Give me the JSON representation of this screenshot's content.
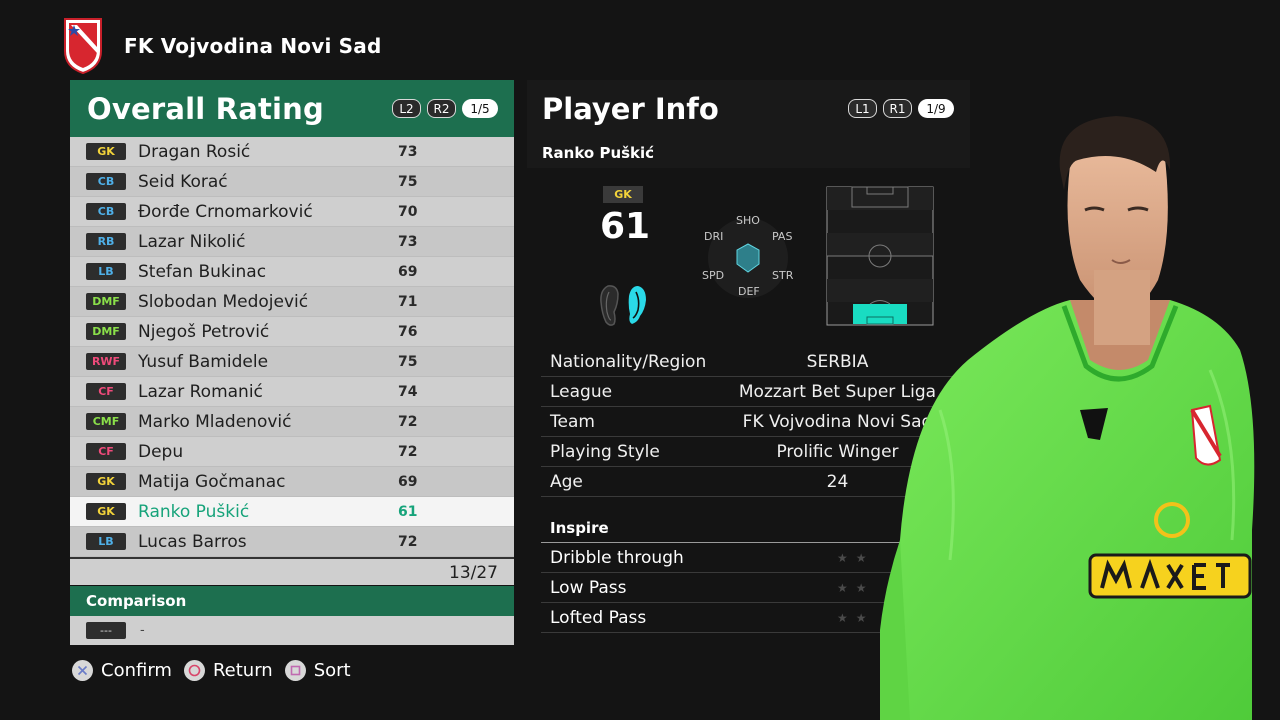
{
  "club": {
    "name": "FK Vojvodina Novi Sad"
  },
  "overall": {
    "title": "Overall Rating",
    "l_button": "L2",
    "r_button": "R2",
    "page": "1/5",
    "players": [
      {
        "pos": "GK",
        "pos_color": "#f2d33a",
        "name": "Dragan Rosić",
        "rating": "73"
      },
      {
        "pos": "CB",
        "pos_color": "#4fb0e8",
        "name": "Seid Korać",
        "rating": "75"
      },
      {
        "pos": "CB",
        "pos_color": "#4fb0e8",
        "name": "Đorđe Crnomarković",
        "rating": "70"
      },
      {
        "pos": "RB",
        "pos_color": "#4fb0e8",
        "name": "Lazar Nikolić",
        "rating": "73"
      },
      {
        "pos": "LB",
        "pos_color": "#4fb0e8",
        "name": "Stefan Bukinac",
        "rating": "69"
      },
      {
        "pos": "DMF",
        "pos_color": "#8be04a",
        "name": "Slobodan Medojević",
        "rating": "71"
      },
      {
        "pos": "DMF",
        "pos_color": "#8be04a",
        "name": "Njegoš Petrović",
        "rating": "76"
      },
      {
        "pos": "RWF",
        "pos_color": "#ef4a7a",
        "name": "Yusuf Bamidele",
        "rating": "75"
      },
      {
        "pos": "CF",
        "pos_color": "#ef4a7a",
        "name": "Lazar Romanić",
        "rating": "74"
      },
      {
        "pos": "CMF",
        "pos_color": "#8be04a",
        "name": "Marko Mladenović",
        "rating": "72"
      },
      {
        "pos": "CF",
        "pos_color": "#ef4a7a",
        "name": "Depu",
        "rating": "72"
      },
      {
        "pos": "GK",
        "pos_color": "#f2d33a",
        "name": "Matija Gočmanac",
        "rating": "69"
      },
      {
        "pos": "GK",
        "pos_color": "#f2d33a",
        "name": "Ranko Puškić",
        "rating": "61",
        "selected": true
      },
      {
        "pos": "LB",
        "pos_color": "#4fb0e8",
        "name": "Lucas Barros",
        "rating": "72"
      }
    ],
    "count": "13/27"
  },
  "comparison": {
    "title": "Comparison",
    "pos": "---",
    "name": "-"
  },
  "controls": {
    "confirm": "Confirm",
    "return": "Return",
    "sort": "Sort"
  },
  "info": {
    "title": "Player Info",
    "l_button": "L1",
    "r_button": "R1",
    "page": "1/9",
    "player_name": "Ranko Puškić",
    "position": "GK",
    "rating": "61",
    "hex_labels": {
      "sho": "SHO",
      "pas": "PAS",
      "str": "STR",
      "def": "DEF",
      "spd": "SPD",
      "dri": "DRI"
    },
    "rows": [
      {
        "key": "Nationality/Region",
        "value": "SERBIA"
      },
      {
        "key": "League",
        "value": "Mozzart Bet Super Liga"
      },
      {
        "key": "Team",
        "value": "FK Vojvodina Novi Sad"
      },
      {
        "key": "Playing Style",
        "value": "Prolific Winger"
      },
      {
        "key": "Age",
        "value": "24"
      }
    ],
    "inspire_title": "Inspire",
    "inspire": [
      {
        "key": "Dribble through"
      },
      {
        "key": "Low Pass"
      },
      {
        "key": "Lofted Pass"
      }
    ]
  },
  "colors": {
    "green": "#1d6f4f",
    "highlight": "#16a37a",
    "kit": "#6fe04f"
  }
}
